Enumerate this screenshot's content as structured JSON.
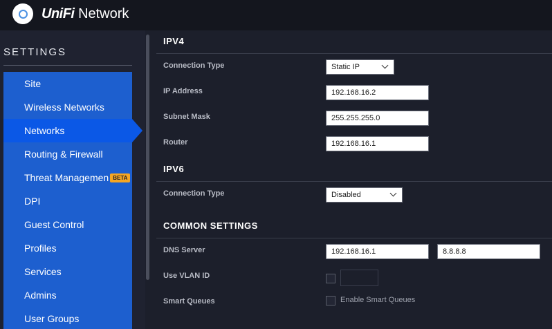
{
  "header": {
    "brand_uni": "UniFi",
    "brand_network": "Network"
  },
  "sidebar": {
    "title": "SETTINGS",
    "items": [
      {
        "label": "Site"
      },
      {
        "label": "Wireless Networks"
      },
      {
        "label": "Networks",
        "active": true
      },
      {
        "label": "Routing & Firewall"
      },
      {
        "label": "Threat Managemen",
        "badge": "BETA"
      },
      {
        "label": "DPI"
      },
      {
        "label": "Guest Control"
      },
      {
        "label": "Profiles"
      },
      {
        "label": "Services"
      },
      {
        "label": "Admins"
      },
      {
        "label": "User Groups"
      }
    ]
  },
  "ipv4": {
    "title": "IPV4",
    "connection_type_label": "Connection Type",
    "connection_type_value": "Static IP",
    "ip_address_label": "IP Address",
    "ip_address_value": "192.168.16.2",
    "subnet_mask_label": "Subnet Mask",
    "subnet_mask_value": "255.255.255.0",
    "router_label": "Router",
    "router_value": "192.168.16.1"
  },
  "ipv6": {
    "title": "IPV6",
    "connection_type_label": "Connection Type",
    "connection_type_value": "Disabled"
  },
  "common": {
    "title": "COMMON SETTINGS",
    "dns_label": "DNS Server",
    "dns_primary": "192.168.16.1",
    "dns_secondary": "8.8.8.8",
    "vlan_label": "Use VLAN ID",
    "smart_queues_label": "Smart Queues",
    "smart_queues_checkbox_label": "Enable Smart Queues"
  },
  "colors": {
    "nav_bg": "#1d5fcf",
    "nav_active": "#0b58e6",
    "beta_badge": "#f5a623",
    "page_bg": "#1c1f2b"
  }
}
